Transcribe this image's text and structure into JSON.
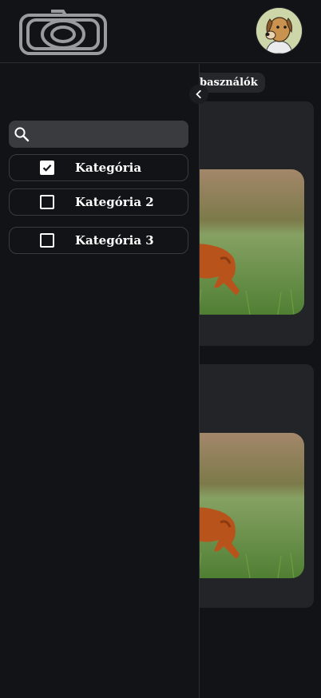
{
  "header": {
    "logo_icon": "camera-aperture-logo",
    "avatar_icon": "cartoon-dog-avatar"
  },
  "background": {
    "chip_label": "basználók",
    "cards": [
      {
        "image": "deer-in-grass-photo"
      },
      {
        "image": "deer-in-grass-photo"
      }
    ]
  },
  "drawer": {
    "collapse_icon": "chevron-left-icon",
    "search": {
      "icon": "search-icon",
      "value": "",
      "placeholder": ""
    },
    "categories": [
      {
        "label": "Kategória",
        "checked": true
      },
      {
        "label": "Kategória 2",
        "checked": false
      },
      {
        "label": "Kategória 3",
        "checked": false
      }
    ]
  },
  "colors": {
    "background": "#121316",
    "panel": "#232428",
    "search_bg": "#3a3b3f",
    "text": "#ffffff"
  }
}
